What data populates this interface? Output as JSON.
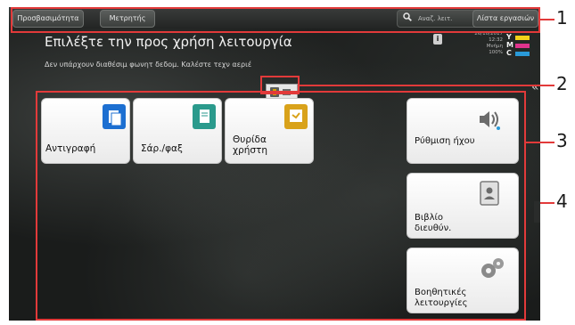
{
  "topbar": {
    "favorites_label": "Προσβασιμότητα",
    "counter_label": "Μετρητής",
    "search_label": "Αναζ. λειτ.",
    "job_list_label": "Λίστα εργασιών"
  },
  "header": {
    "title": "Επιλέξτε την προς χρήση λειτουργία",
    "message": "Δεν υπάρχουν διαθέσιμ φωνητ δεδομ. Καλέστε τεχν αεριέ",
    "info_icon_label": "i",
    "date": "26/10/2017",
    "time": "12:32",
    "memory_label": "Μνήμη",
    "memory_value": "100%"
  },
  "toner": {
    "items": [
      {
        "letter": "Y",
        "color": "#f2d21a"
      },
      {
        "letter": "M",
        "color": "#e0338c"
      },
      {
        "letter": "C",
        "color": "#2a9ad8"
      }
    ]
  },
  "tiles": {
    "copy": "Αντιγραφή",
    "scan_fax": "Σάρ./φαξ",
    "user_box": "Θυρίδα χρήστη",
    "sound": "Ρύθμιση ήχου",
    "address_book": "Βιβλίο διευθύν.",
    "utility": "Βοηθητικές λειτουργίες"
  },
  "callouts": {
    "n1": "1",
    "n2": "2",
    "n3": "3",
    "n4": "4"
  },
  "colors": {
    "callout": "#e23a3a",
    "copy_icon": "#1c6fd1",
    "scan_icon": "#2a9a8c",
    "box_icon": "#d9a21a",
    "sound_icon": "#6b6b6b"
  }
}
